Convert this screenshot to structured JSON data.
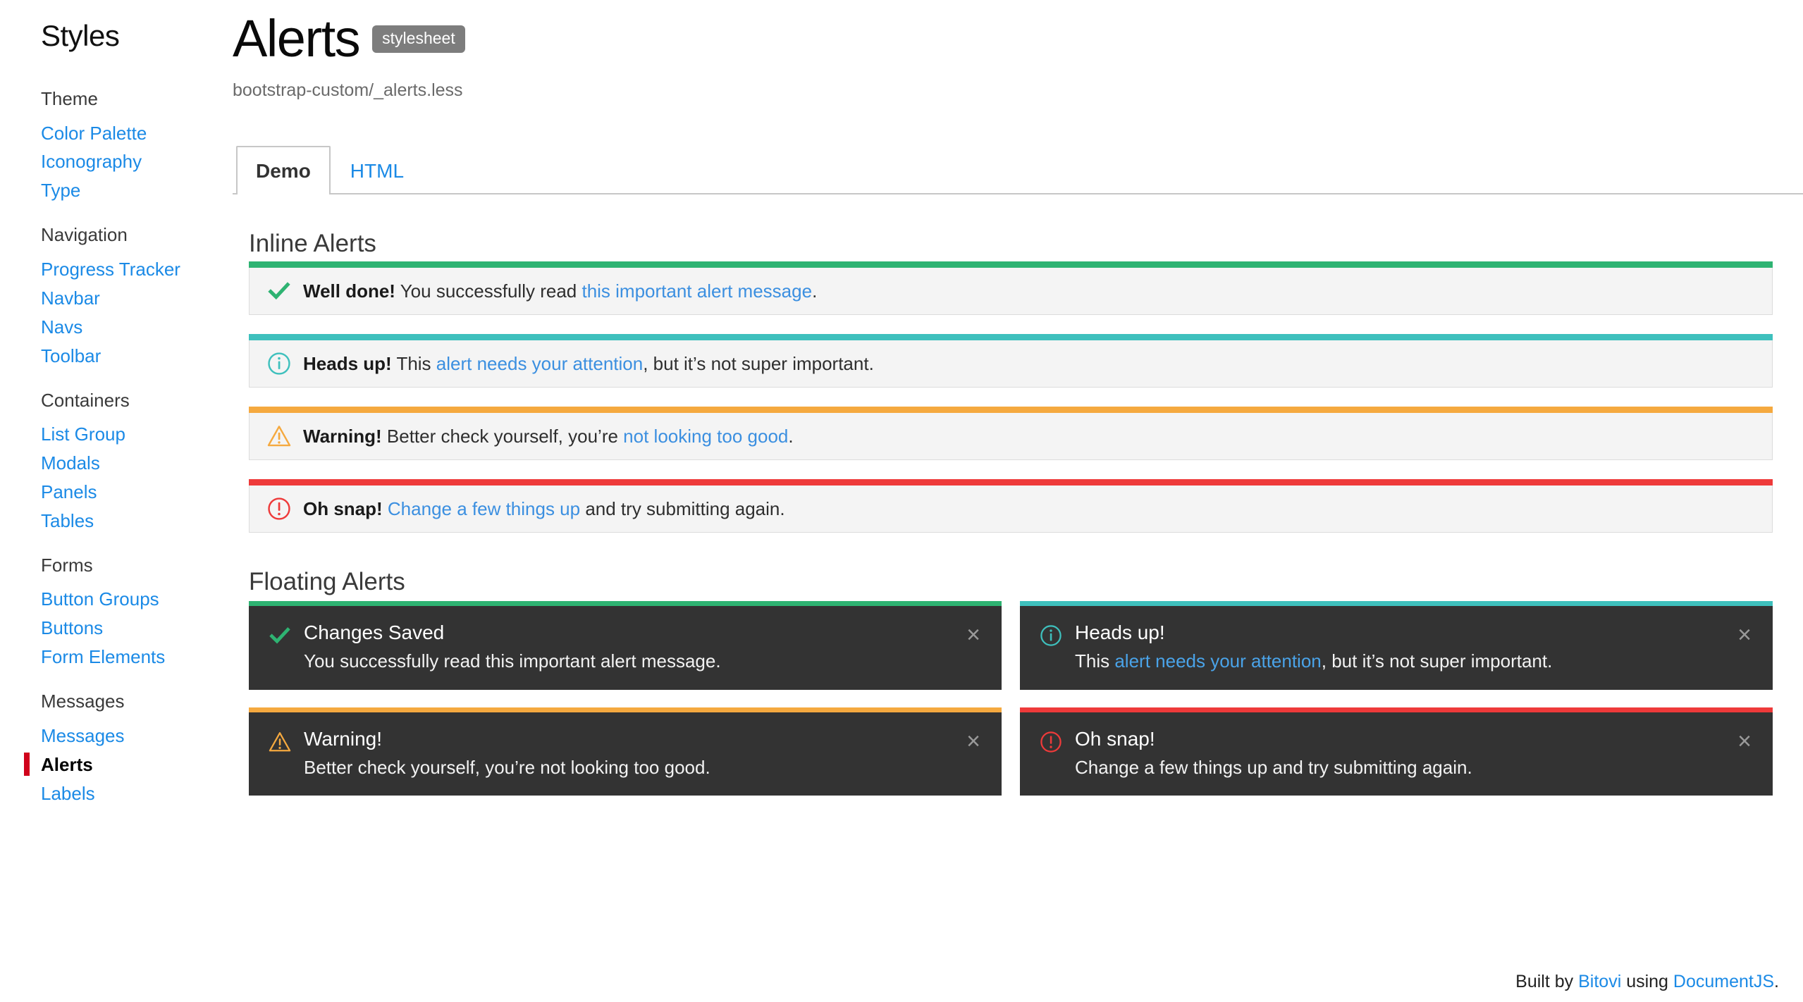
{
  "sidebar": {
    "title": "Styles",
    "groups": [
      {
        "title": "Theme",
        "items": [
          {
            "label": "Color Palette",
            "active": false
          },
          {
            "label": "Iconography",
            "active": false
          },
          {
            "label": "Type",
            "active": false
          }
        ]
      },
      {
        "title": "Navigation",
        "items": [
          {
            "label": "Progress Tracker",
            "active": false
          },
          {
            "label": "Navbar",
            "active": false
          },
          {
            "label": "Navs",
            "active": false
          },
          {
            "label": "Toolbar",
            "active": false
          }
        ]
      },
      {
        "title": "Containers",
        "items": [
          {
            "label": "List Group",
            "active": false
          },
          {
            "label": "Modals",
            "active": false
          },
          {
            "label": "Panels",
            "active": false
          },
          {
            "label": "Tables",
            "active": false
          }
        ]
      },
      {
        "title": "Forms",
        "items": [
          {
            "label": "Button Groups",
            "active": false
          },
          {
            "label": "Buttons",
            "active": false
          },
          {
            "label": "Form Elements",
            "active": false
          }
        ]
      },
      {
        "title": "Messages",
        "items": [
          {
            "label": "Messages",
            "active": false
          },
          {
            "label": "Alerts",
            "active": true
          },
          {
            "label": "Labels",
            "active": false
          }
        ]
      }
    ]
  },
  "header": {
    "title": "Alerts",
    "badge": "stylesheet",
    "file_path": "bootstrap-custom/_alerts.less"
  },
  "tabs": [
    {
      "label": "Demo",
      "active": true
    },
    {
      "label": "HTML",
      "active": false
    }
  ],
  "sections": {
    "inline_heading": "Inline Alerts",
    "floating_heading": "Floating Alerts"
  },
  "colors": {
    "success": "#2eb372",
    "info": "#3ec0bd",
    "warning": "#f5a93f",
    "danger": "#ee3a3a",
    "link": "#3b8fe0",
    "sidebar_link": "#1b8ae6",
    "active_marker": "#d0021b",
    "floating_bg": "#333333",
    "inline_bg": "#f4f4f4"
  },
  "inline_alerts": [
    {
      "type": "success",
      "icon": "check-icon",
      "accent": "#2eb372",
      "strong": "Well done!",
      "text_before": " You successfully read ",
      "link": "this important alert message",
      "text_after": "."
    },
    {
      "type": "info",
      "icon": "info-circle-icon",
      "accent": "#3ec0bd",
      "strong": "Heads up!",
      "text_before": " This ",
      "link": "alert needs your attention",
      "text_after": ", but it’s not super important."
    },
    {
      "type": "warning",
      "icon": "warning-triangle-icon",
      "accent": "#f5a93f",
      "strong": "Warning!",
      "text_before": " Better check yourself, you’re ",
      "link": "not looking too good",
      "text_after": "."
    },
    {
      "type": "danger",
      "icon": "exclamation-circle-icon",
      "accent": "#ee3a3a",
      "strong": "Oh snap!",
      "text_before": " ",
      "link": "Change a few things up",
      "text_after": " and try submitting again."
    }
  ],
  "floating_alerts": [
    {
      "type": "success",
      "icon": "check-icon",
      "accent": "#2eb372",
      "title": "Changes Saved",
      "text_before": "You successfully read this important alert message.",
      "link": "",
      "text_after": "",
      "close_label": "×"
    },
    {
      "type": "info",
      "icon": "info-circle-icon",
      "accent": "#3ec0bd",
      "title": "Heads up!",
      "text_before": "This ",
      "link": "alert needs your attention",
      "text_after": ", but it’s not super important.",
      "close_label": "×"
    },
    {
      "type": "warning",
      "icon": "warning-triangle-icon",
      "accent": "#f5a93f",
      "title": "Warning!",
      "text_before": "Better check yourself, you’re not looking too good.",
      "link": "",
      "text_after": "",
      "close_label": "×"
    },
    {
      "type": "danger",
      "icon": "exclamation-circle-icon",
      "accent": "#ee3a3a",
      "title": "Oh snap!",
      "text_before": "Change a few things up and try submitting again.",
      "link": "",
      "text_after": "",
      "close_label": "×"
    }
  ],
  "footer": {
    "built_by": "Built by ",
    "bitovi": "Bitovi",
    "using": " using ",
    "documentjs": "DocumentJS",
    "period": "."
  }
}
